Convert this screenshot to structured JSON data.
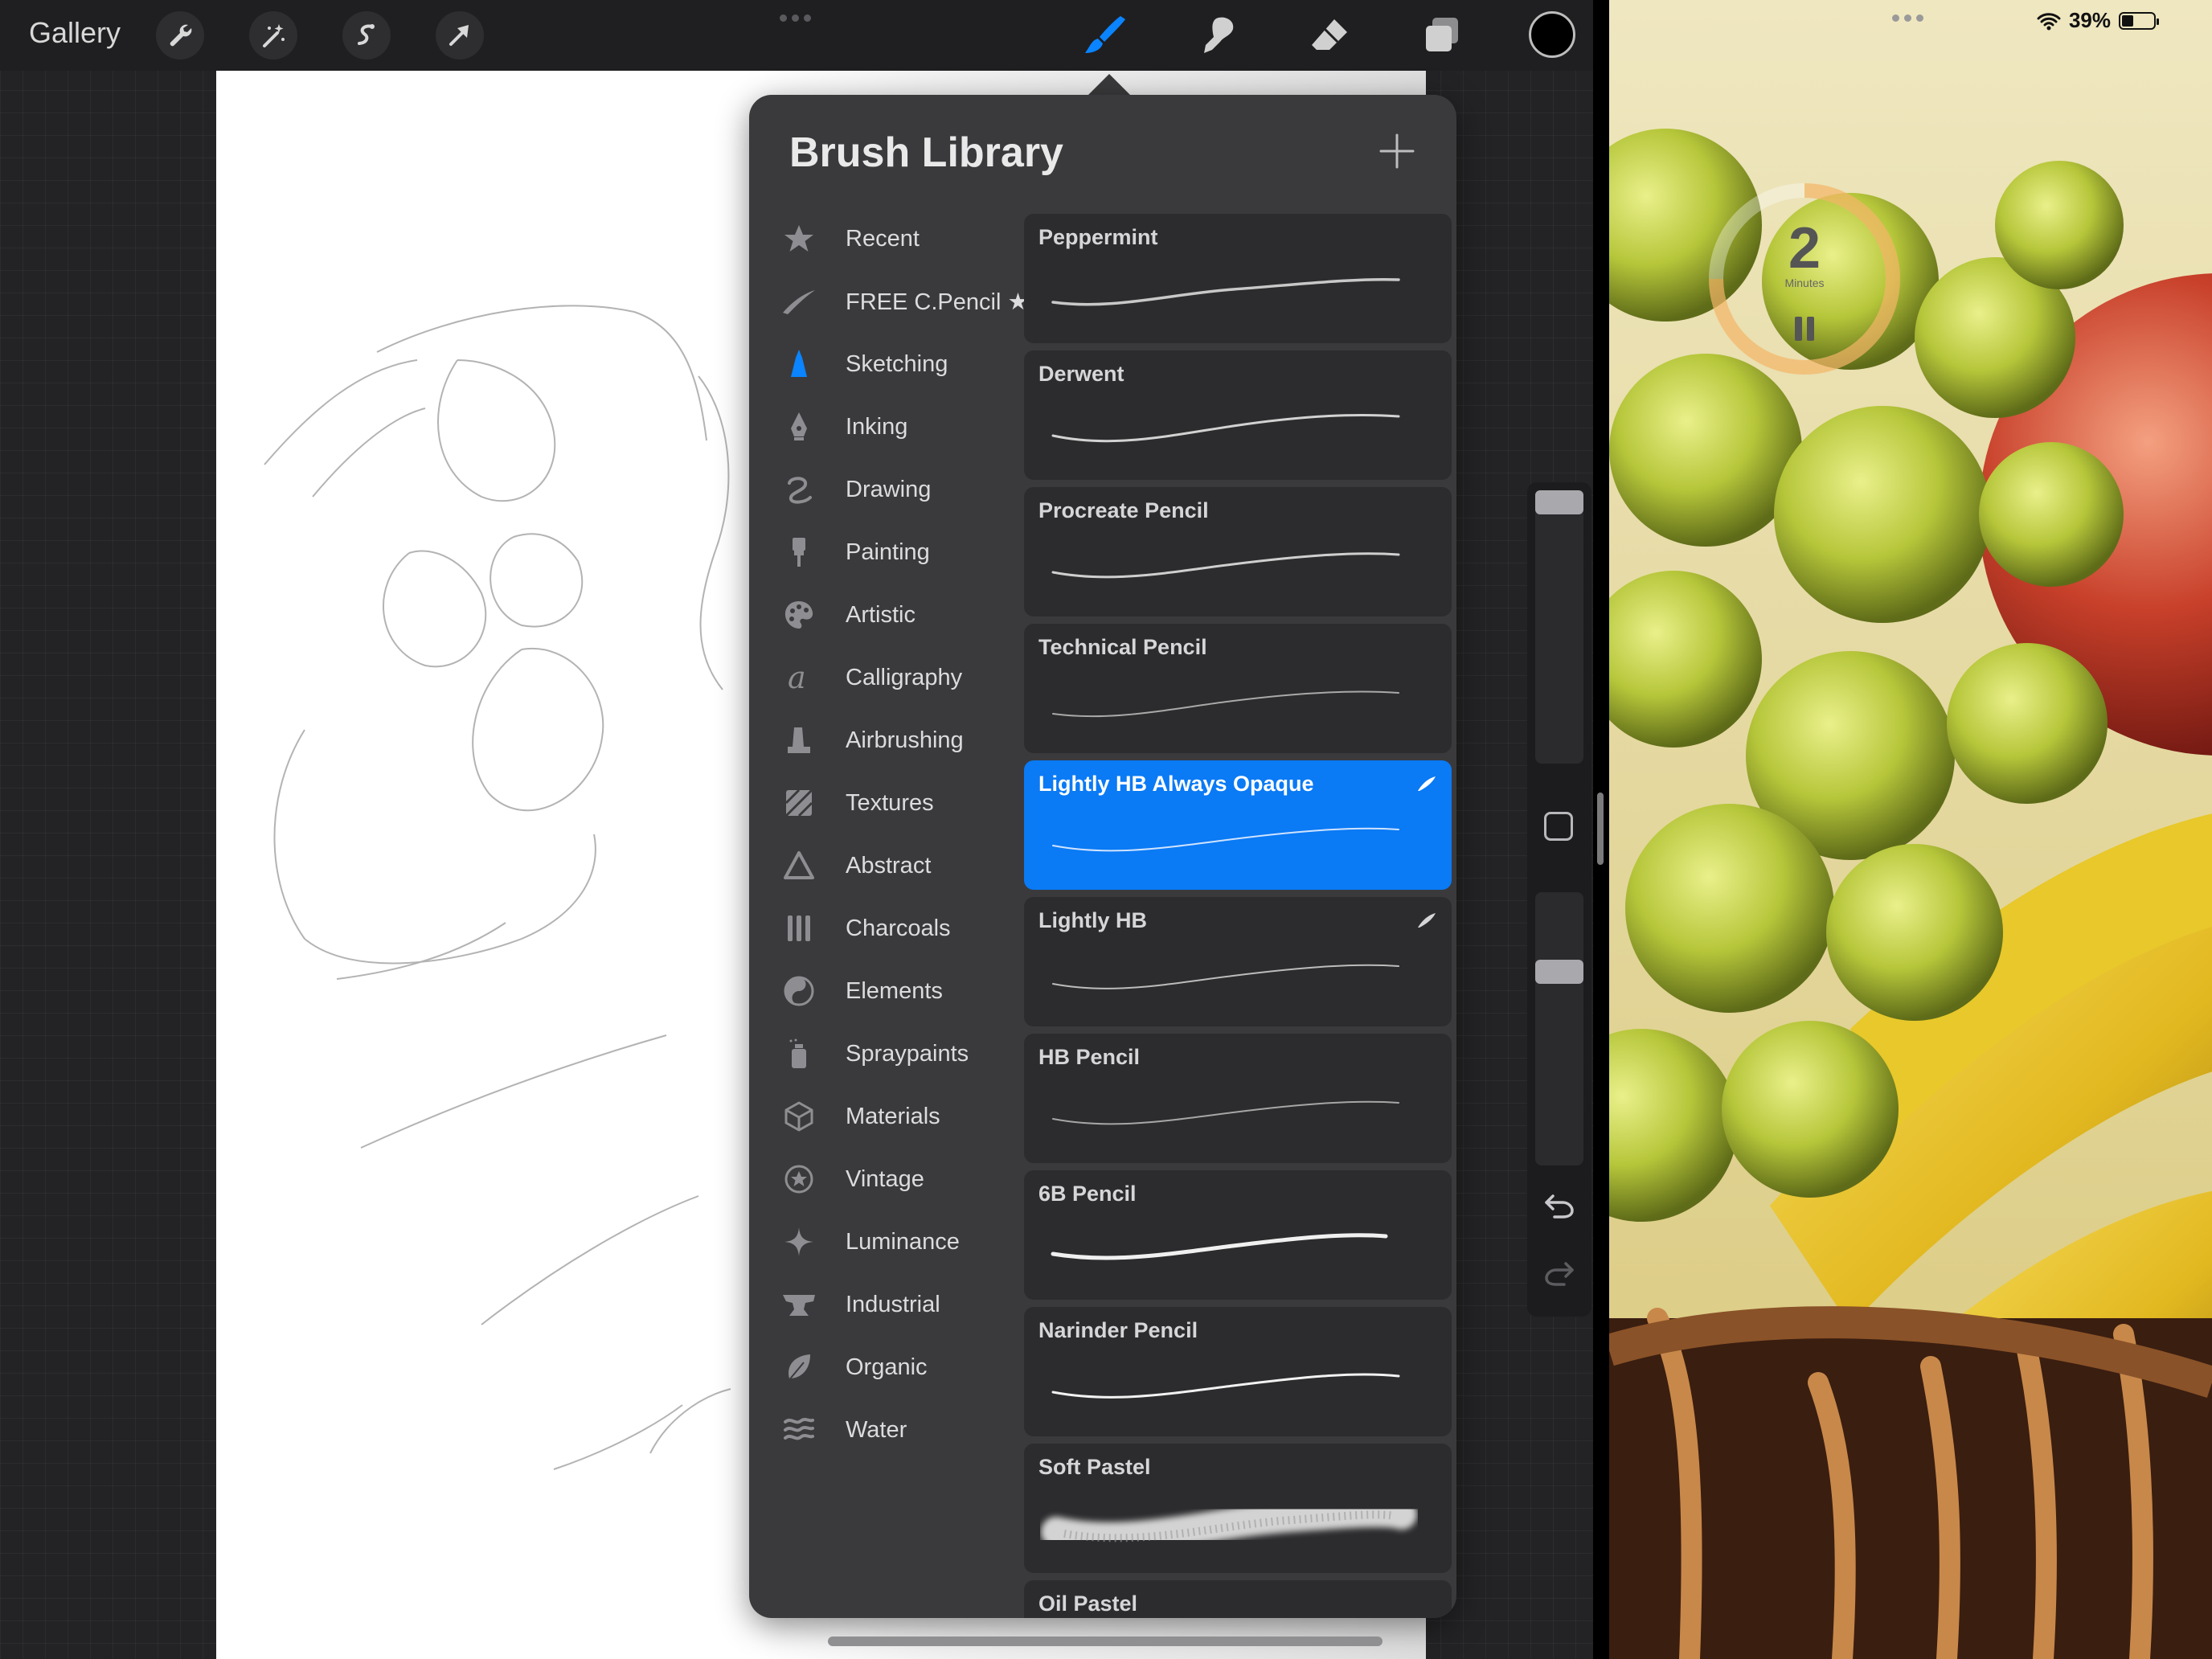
{
  "toolbar": {
    "gallery_label": "Gallery",
    "left_tools": [
      "wrench-icon",
      "magic-wand-icon",
      "selection-icon",
      "transform-arrow-icon"
    ],
    "right_tools": [
      "brush-icon",
      "smudge-icon",
      "eraser-icon",
      "layers-icon"
    ],
    "active_tool": "brush-icon",
    "current_color": "#000000"
  },
  "brush_library": {
    "title": "Brush Library",
    "categories": [
      {
        "label": "Recent",
        "icon": "star-icon"
      },
      {
        "label": "FREE C.Pencil ★",
        "icon": "stroke-icon"
      },
      {
        "label": "Sketching",
        "icon": "pencil-tip-icon",
        "active": true
      },
      {
        "label": "Inking",
        "icon": "pen-nib-icon"
      },
      {
        "label": "Drawing",
        "icon": "squiggle-icon"
      },
      {
        "label": "Painting",
        "icon": "paintbrush-icon"
      },
      {
        "label": "Artistic",
        "icon": "palette-icon"
      },
      {
        "label": "Calligraphy",
        "icon": "calligraphy-a-icon"
      },
      {
        "label": "Airbrushing",
        "icon": "airbrush-icon"
      },
      {
        "label": "Textures",
        "icon": "texture-icon"
      },
      {
        "label": "Abstract",
        "icon": "triangle-icon"
      },
      {
        "label": "Charcoals",
        "icon": "charcoal-icon"
      },
      {
        "label": "Elements",
        "icon": "yin-yang-icon"
      },
      {
        "label": "Spraypaints",
        "icon": "spray-can-icon"
      },
      {
        "label": "Materials",
        "icon": "cube-icon"
      },
      {
        "label": "Vintage",
        "icon": "vintage-star-icon"
      },
      {
        "label": "Luminance",
        "icon": "sparkle-icon"
      },
      {
        "label": "Industrial",
        "icon": "anvil-icon"
      },
      {
        "label": "Organic",
        "icon": "leaf-icon"
      },
      {
        "label": "Water",
        "icon": "waves-icon"
      }
    ],
    "brushes": [
      {
        "name": "Peppermint"
      },
      {
        "name": "Derwent"
      },
      {
        "name": "Procreate Pencil"
      },
      {
        "name": "Technical Pencil"
      },
      {
        "name": "Lightly HB Always Opaque",
        "selected": true,
        "imported": true
      },
      {
        "name": "Lightly HB",
        "imported": true
      },
      {
        "name": "HB Pencil"
      },
      {
        "name": "6B Pencil"
      },
      {
        "name": "Narinder Pencil"
      },
      {
        "name": "Soft Pastel"
      },
      {
        "name": "Oil Pastel"
      }
    ],
    "selected_color": "#0a7af5"
  },
  "status": {
    "battery": "39%"
  },
  "timer": {
    "value": "2",
    "unit": "Minutes"
  }
}
